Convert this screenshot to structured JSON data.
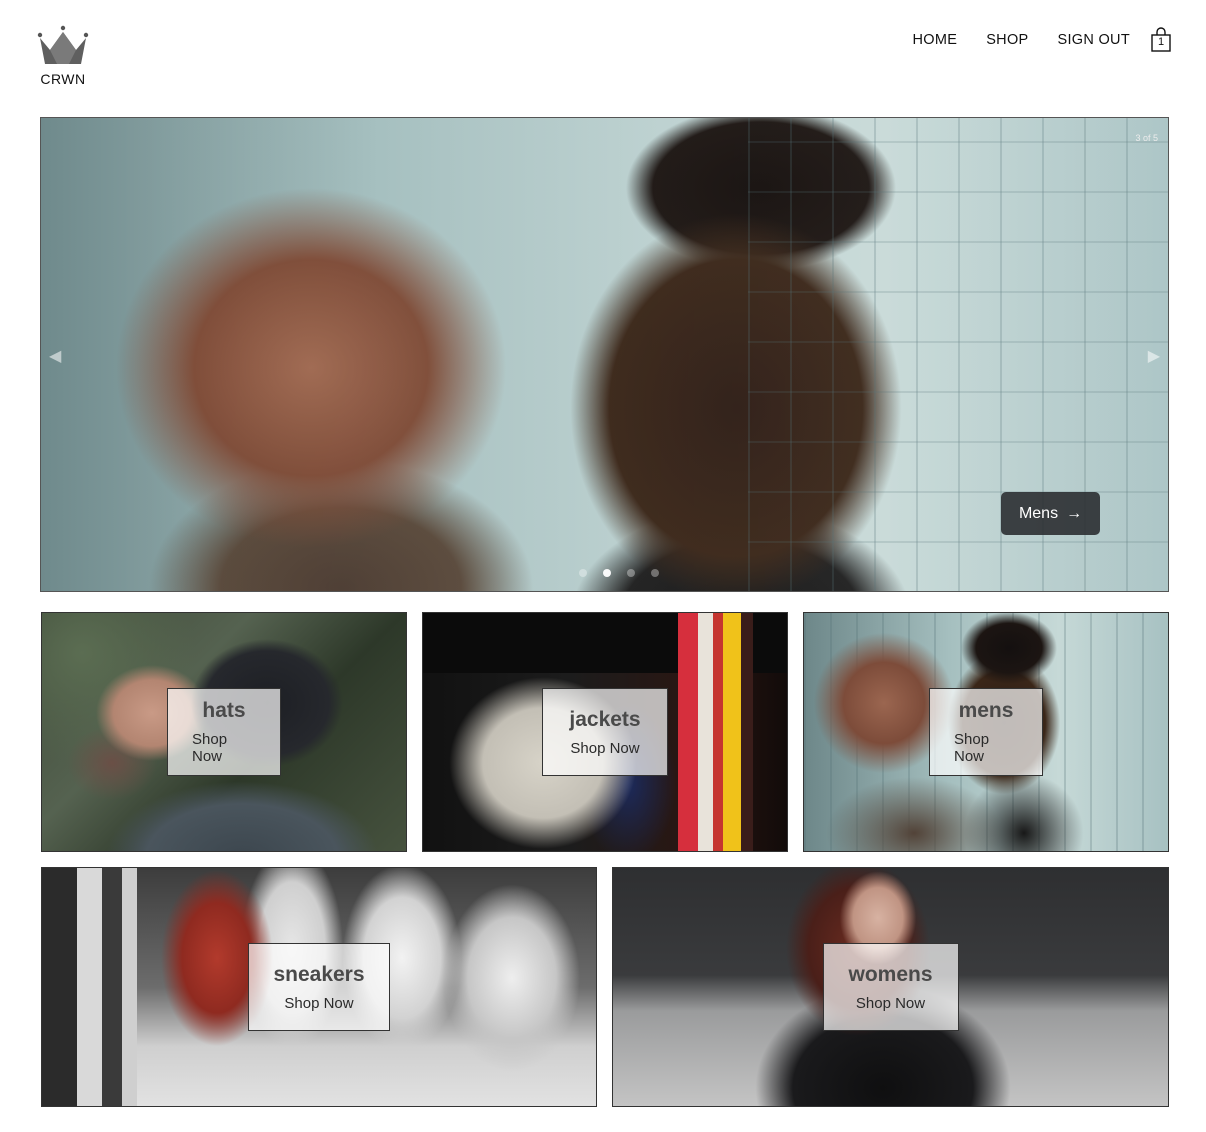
{
  "header": {
    "logo_text": "CRWN",
    "logo_icon": "crown-icon",
    "nav": [
      {
        "label": "HOME"
      },
      {
        "label": "SHOP"
      },
      {
        "label": "SIGN OUT"
      }
    ],
    "cart": {
      "icon": "shopping-bag-icon",
      "count": "1"
    }
  },
  "hero": {
    "slide_counter": "3 of 5",
    "prev_icon": "chevron-left-icon",
    "next_icon": "chevron-right-icon",
    "cta_label": "Mens",
    "cta_arrow": "→",
    "dots_total": 4,
    "dots_active_index": 1
  },
  "categories": [
    {
      "title": "hats",
      "subtitle": "Shop Now"
    },
    {
      "title": "jackets",
      "subtitle": "Shop Now"
    },
    {
      "title": "mens",
      "subtitle": "Shop Now"
    },
    {
      "title": "sneakers",
      "subtitle": "Shop Now"
    },
    {
      "title": "womens",
      "subtitle": "Shop Now"
    }
  ],
  "colors": {
    "text": "#111111",
    "cta_background": "#2b2d30",
    "label_background": "#ffffffb3"
  }
}
